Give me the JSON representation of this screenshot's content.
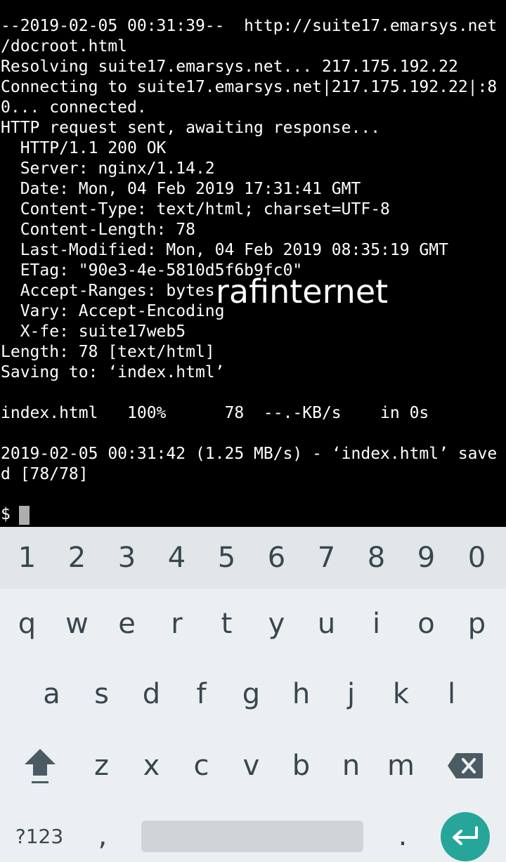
{
  "terminal": {
    "lines": [
      "--2019-02-05 00:31:39--  http://suite17.emarsys.net",
      "/docroot.html",
      "Resolving suite17.emarsys.net... 217.175.192.22",
      "Connecting to suite17.emarsys.net|217.175.192.22|:8",
      "0... connected.",
      "HTTP request sent, awaiting response...",
      "  HTTP/1.1 200 OK",
      "  Server: nginx/1.14.2",
      "  Date: Mon, 04 Feb 2019 17:31:41 GMT",
      "  Content-Type: text/html; charset=UTF-8",
      "  Content-Length: 78",
      "  Last-Modified: Mon, 04 Feb 2019 08:35:19 GMT",
      "  ETag: \"90e3-4e-5810d5f6b9fc0\"",
      "  Accept-Ranges: bytes",
      "  Vary: Accept-Encoding",
      "  X-fe: suite17web5",
      "Length: 78 [text/html]",
      "Saving to: ‘index.html’",
      "",
      "index.html   100%      78  --.-KB/s    in 0s",
      "",
      "2019-02-05 00:31:42 (1.25 MB/s) - ‘index.html’ save",
      "d [78/78]"
    ],
    "prompt": "$ ",
    "watermark": "rafinternet"
  },
  "keyboard": {
    "number_row": [
      "1",
      "2",
      "3",
      "4",
      "5",
      "6",
      "7",
      "8",
      "9",
      "0"
    ],
    "row1": [
      "q",
      "w",
      "e",
      "r",
      "t",
      "y",
      "u",
      "i",
      "o",
      "p"
    ],
    "row2": [
      "a",
      "s",
      "d",
      "f",
      "g",
      "h",
      "j",
      "k",
      "l"
    ],
    "row3": [
      "z",
      "x",
      "c",
      "v",
      "b",
      "n",
      "m"
    ],
    "symbols_label": "?123",
    "comma_label": ",",
    "period_label": ".",
    "accent_color": "#26a69a",
    "icons": {
      "shift": "shift-arrow-icon",
      "backspace": "backspace-icon",
      "enter": "enter-arrow-icon"
    }
  }
}
